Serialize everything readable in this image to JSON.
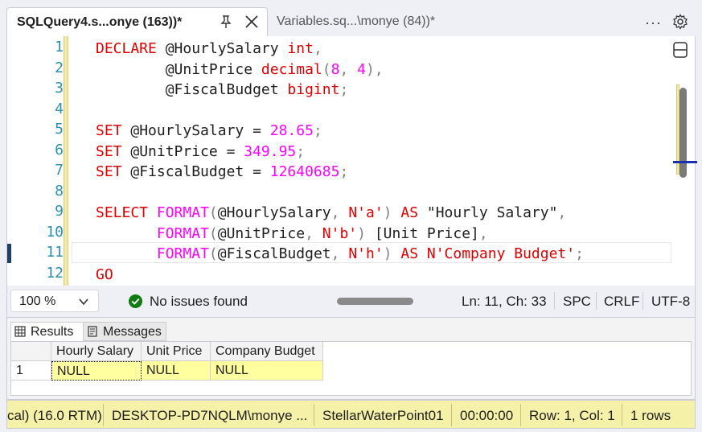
{
  "tabs": {
    "active_title": "SQLQuery4.s...onye (163))*",
    "inactive_title": "Variables.sq...\\monye (84))*"
  },
  "editor": {
    "line_numbers": [
      "1",
      "2",
      "3",
      "4",
      "5",
      "6",
      "7",
      "8",
      "9",
      "10",
      "11",
      "12"
    ],
    "lines": [
      [
        [
          "kred",
          "DECLARE "
        ],
        [
          "dark",
          "@HourlySalary "
        ],
        [
          "kred",
          "int"
        ],
        [
          "gry",
          ","
        ]
      ],
      [
        [
          "dark",
          "        @UnitPrice "
        ],
        [
          "kred",
          "decimal"
        ],
        [
          "gry",
          "("
        ],
        [
          "mag",
          "8"
        ],
        [
          "gry",
          ", "
        ],
        [
          "mag",
          "4"
        ],
        [
          "gry",
          "),"
        ]
      ],
      [
        [
          "dark",
          "        @FiscalBudget "
        ],
        [
          "kred",
          "bigint"
        ],
        [
          "gry",
          ";"
        ]
      ],
      [],
      [
        [
          "kred",
          "SET "
        ],
        [
          "dark",
          "@HourlySalary = "
        ],
        [
          "mag",
          "28.65"
        ],
        [
          "gry",
          ";"
        ]
      ],
      [
        [
          "kred",
          "SET "
        ],
        [
          "dark",
          "@UnitPrice = "
        ],
        [
          "mag",
          "349.95"
        ],
        [
          "gry",
          ";"
        ]
      ],
      [
        [
          "kred",
          "SET "
        ],
        [
          "dark",
          "@FiscalBudget = "
        ],
        [
          "mag",
          "12640685"
        ],
        [
          "gry",
          ";"
        ]
      ],
      [],
      [
        [
          "kred",
          "SELECT "
        ],
        [
          "mag",
          "FORMAT"
        ],
        [
          "gry",
          "("
        ],
        [
          "dark",
          "@HourlySalary"
        ],
        [
          "gry",
          ", "
        ],
        [
          "kred",
          "N'a'"
        ],
        [
          "gry",
          ") "
        ],
        [
          "kred",
          "AS "
        ],
        [
          "dark",
          "\"Hourly Salary\""
        ],
        [
          "gry",
          ","
        ]
      ],
      [
        [
          "dark",
          "       "
        ],
        [
          "mag",
          "FORMAT"
        ],
        [
          "gry",
          "("
        ],
        [
          "dark",
          "@UnitPrice"
        ],
        [
          "gry",
          ", "
        ],
        [
          "kred",
          "N'b'"
        ],
        [
          "gry",
          ") "
        ],
        [
          "dark",
          "[Unit Price]"
        ],
        [
          "gry",
          ","
        ]
      ],
      [
        [
          "dark",
          "       "
        ],
        [
          "mag",
          "FORMAT"
        ],
        [
          "gry",
          "("
        ],
        [
          "dark",
          "@FiscalBudget"
        ],
        [
          "gry",
          ", "
        ],
        [
          "kred",
          "N'h'"
        ],
        [
          "gry",
          ") "
        ],
        [
          "kred",
          "AS "
        ],
        [
          "kred",
          "N'Company Budget'"
        ],
        [
          "gry",
          ";"
        ]
      ],
      [
        [
          "kred",
          "GO"
        ]
      ]
    ]
  },
  "status": {
    "zoom": "100 %",
    "issues": "No issues found",
    "position": "Ln: 11, Ch: 33",
    "indent": "SPC",
    "eol": "CRLF",
    "encoding": "UTF-8"
  },
  "results": {
    "tab_results": "Results",
    "tab_messages": "Messages",
    "columns": [
      "Hourly Salary",
      "Unit Price",
      "Company Budget"
    ],
    "rows": [
      {
        "num": "1",
        "cells": [
          "NULL",
          "NULL",
          "NULL"
        ]
      }
    ]
  },
  "bottom_status": {
    "server_version": "cal) (16.0 RTM)",
    "login": "DESKTOP-PD7NQLM\\monye ...",
    "database": "StellarWaterPoint01",
    "elapsed": "00:00:00",
    "rowcol": "Row: 1, Col: 1",
    "rows": "1 rows"
  },
  "colors": {
    "keyword": "#e00000",
    "function_number": "#ff00ff",
    "line_number": "#2b91af",
    "selected_cell": "#ffff9f",
    "status_bar": "#f5f1a8"
  }
}
